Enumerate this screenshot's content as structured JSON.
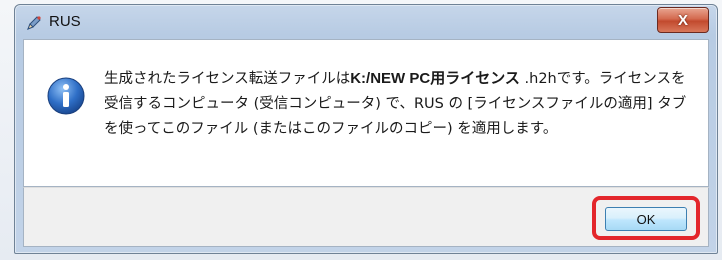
{
  "window": {
    "title": "RUS",
    "app_icon": "pencil-icon",
    "close_label": "X"
  },
  "message": {
    "part1": "生成されたライセンス転送ファイルは",
    "path": "K:/NEW PC用ライセンス",
    "part2": " .h2hです。ライセンスを受信するコンピュータ (受信コンピュータ) で、RUS の [ライセンスファイルの適用] タブを使ってこのファイル (またはこのファイルのコピー) を適用します。",
    "icon": "info-icon"
  },
  "buttons": {
    "ok_label": "OK"
  },
  "colors": {
    "highlight": "#e3262b",
    "info_icon": "#2f6fc7",
    "close_button": "#c24a2e"
  }
}
